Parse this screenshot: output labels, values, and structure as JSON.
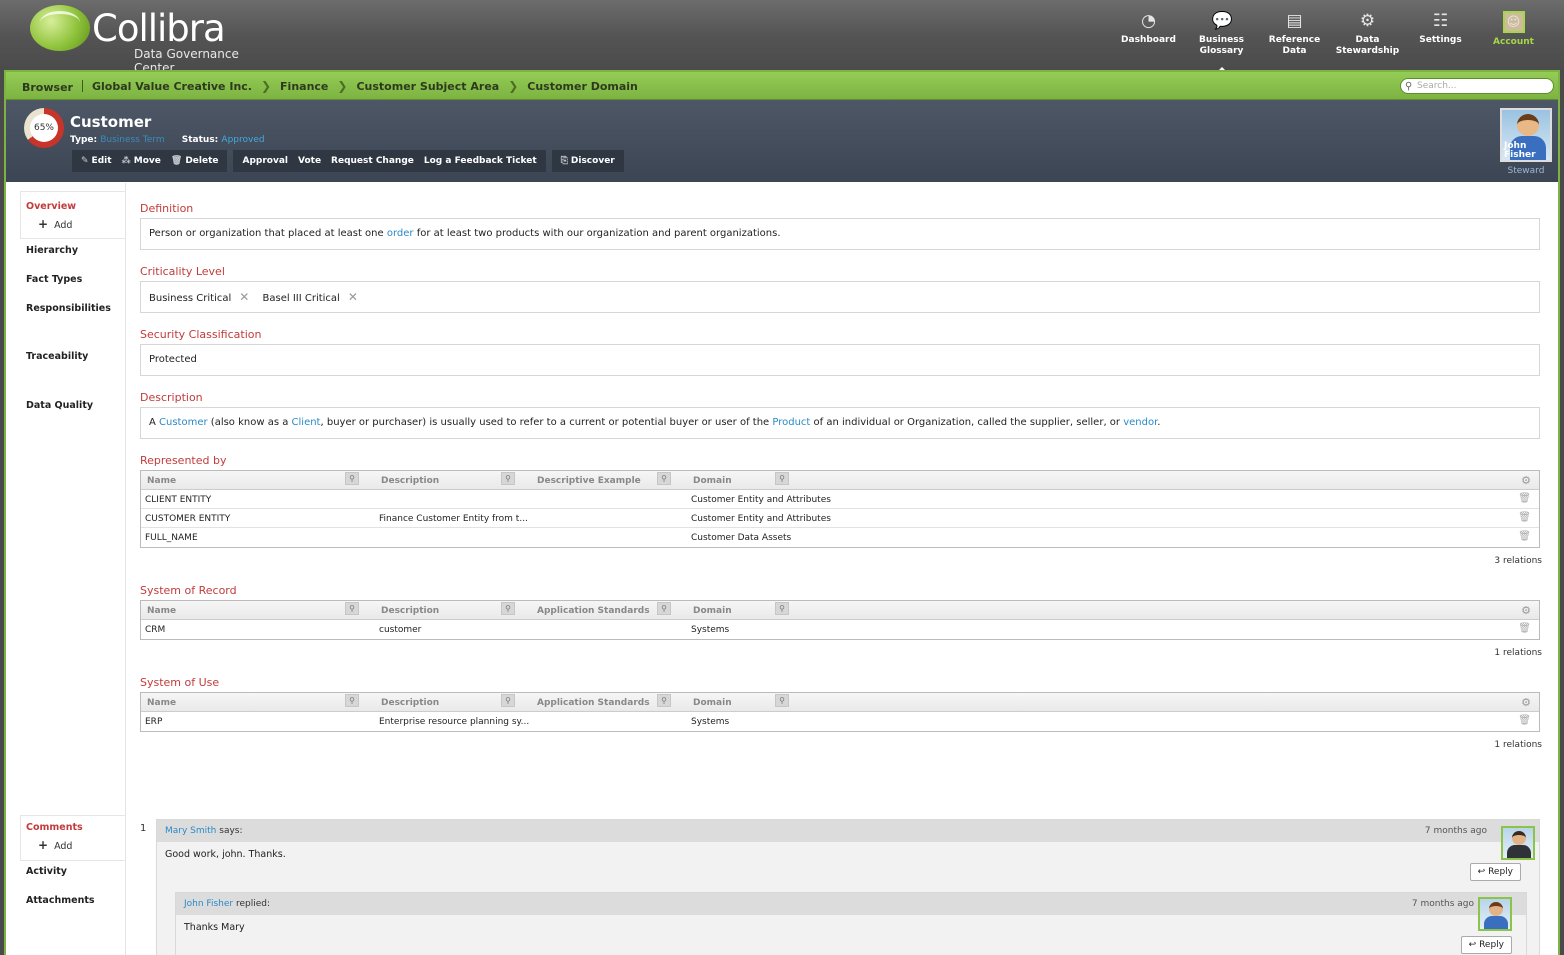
{
  "header": {
    "brand": "Collibra",
    "tagline": "Data Governance Center",
    "nav": [
      {
        "label": "Dashboard",
        "icon": "dashboard-icon"
      },
      {
        "label": "Business\nGlossary",
        "icon": "speech-bubble-icon"
      },
      {
        "label": "Reference\nData",
        "icon": "reference-data-icon"
      },
      {
        "label": "Data\nStewardship",
        "icon": "stewardship-icon"
      },
      {
        "label": "Settings",
        "icon": "settings-icon"
      },
      {
        "label": "Account",
        "icon": "avatar-icon"
      }
    ]
  },
  "breadcrumb": {
    "root": "Browser",
    "items": [
      "Global Value Creative Inc.",
      "Finance",
      "Customer Subject Area",
      "Customer Domain"
    ],
    "search_placeholder": "Search..."
  },
  "asset": {
    "completeness": "65%",
    "completeness_value": 65,
    "name": "Customer",
    "type_label": "Type:",
    "type_value": "Business Term",
    "status_label": "Status:",
    "status_value": "Approved",
    "actions_1": [
      "Edit",
      "Move",
      "Delete"
    ],
    "actions_2": [
      "Approval",
      "Vote",
      "Request Change",
      "Log a Feedback Ticket"
    ],
    "actions_3": [
      "Discover"
    ],
    "steward_name": "John\nFisher",
    "steward_role": "Steward"
  },
  "sidenav": {
    "overview": "Overview",
    "add": "Add",
    "hierarchy": "Hierarchy",
    "fact_types": "Fact Types",
    "responsibilities": "Responsibilities",
    "traceability": "Traceability",
    "data_quality": "Data Quality",
    "comments": "Comments",
    "comments_add": "Add",
    "activity": "Activity",
    "attachments": "Attachments"
  },
  "definition": {
    "title": "Definition",
    "text_before": "Person or organization that placed at least one ",
    "link": "order",
    "text_after": " for at least two products with our organization and parent organizations."
  },
  "criticality": {
    "title": "Criticality Level",
    "tags": [
      "Business Critical",
      "Basel III Critical"
    ]
  },
  "security": {
    "title": "Security Classification",
    "value": "Protected"
  },
  "description": {
    "title": "Description",
    "t1": "A ",
    "l1": "Customer",
    "t2": " (also know as a ",
    "l2": "Client",
    "t3": ", buyer or purchaser) is usually used to refer to a current or potential buyer or user of the ",
    "l3": "Product",
    "t4": " of an individual or Organization, called the supplier, seller, or ",
    "l4": "vendor",
    "t5": "."
  },
  "represented_by": {
    "title": "Represented by",
    "columns": [
      "Name",
      "Description",
      "Descriptive Example",
      "Domain"
    ],
    "rows": [
      [
        "CLIENT ENTITY",
        "",
        "",
        "Customer Entity and Attributes"
      ],
      [
        "CUSTOMER ENTITY",
        "Finance Customer Entity from t...",
        "",
        "Customer Entity and Attributes"
      ],
      [
        "FULL_NAME",
        "",
        "",
        "Customer Data Assets"
      ]
    ],
    "count": "3 relations"
  },
  "system_of_record": {
    "title": "System of Record",
    "columns": [
      "Name",
      "Description",
      "Application Standards",
      "Domain"
    ],
    "rows": [
      [
        "CRM",
        "customer",
        "",
        "Systems"
      ]
    ],
    "count": "1 relations"
  },
  "system_of_use": {
    "title": "System of Use",
    "columns": [
      "Name",
      "Description",
      "Application Standards",
      "Domain"
    ],
    "rows": [
      [
        "ERP",
        "Enterprise resource planning sy...",
        "",
        "Systems"
      ]
    ],
    "count": "1 relations"
  },
  "comments": {
    "number": "1",
    "c1": {
      "author": "Mary Smith",
      "verb": " says:",
      "time": "7 months ago",
      "text": "Good work, john. Thanks.",
      "reply": "Reply"
    },
    "c2": {
      "author": "John Fisher",
      "verb": " replied:",
      "time": "7 months ago",
      "text": "Thanks Mary",
      "reply": "Reply"
    }
  },
  "colors": {
    "accent_green": "#7cb342",
    "section_red": "#c23b3b",
    "link_blue": "#2a8ac8",
    "header_dark": "#3c4553"
  }
}
